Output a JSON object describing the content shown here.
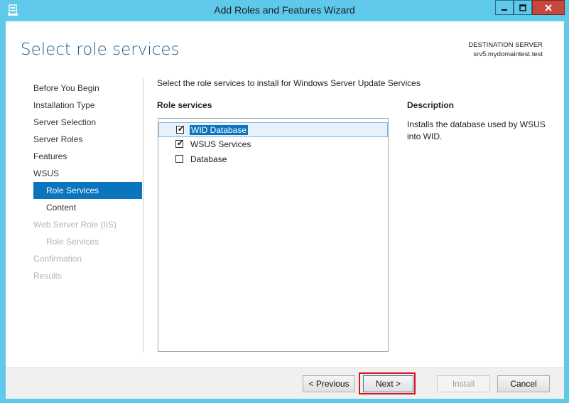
{
  "window": {
    "title": "Add Roles and Features Wizard",
    "controls": {
      "minimize": "minimize-icon",
      "maximize": "maximize-icon",
      "close": "close-icon"
    },
    "colors": {
      "frame": "#5fc9ec",
      "accent": "#0a74bd",
      "heading": "#1c5a8c",
      "highlight": "#e0141c"
    }
  },
  "header": {
    "title": "Select role services",
    "destination_label": "DESTINATION SERVER",
    "destination_server": "srv5.mydomaintest.test"
  },
  "nav": {
    "items": [
      {
        "label": "Before You Begin",
        "state": "normal"
      },
      {
        "label": "Installation Type",
        "state": "normal"
      },
      {
        "label": "Server Selection",
        "state": "normal"
      },
      {
        "label": "Server Roles",
        "state": "normal"
      },
      {
        "label": "Features",
        "state": "normal"
      },
      {
        "label": "WSUS",
        "state": "normal"
      },
      {
        "label": "Role Services",
        "state": "selected",
        "sub": true
      },
      {
        "label": "Content",
        "state": "normal",
        "sub": true
      },
      {
        "label": "Web Server Role (IIS)",
        "state": "disabled"
      },
      {
        "label": "Role Services",
        "state": "disabled",
        "sub": true
      },
      {
        "label": "Confirmation",
        "state": "disabled"
      },
      {
        "label": "Results",
        "state": "disabled"
      }
    ]
  },
  "main": {
    "intro": "Select the role services to install for Windows Server Update Services",
    "role_services_label": "Role services",
    "role_services": [
      {
        "label": "WID Database",
        "checked": true,
        "selected": true
      },
      {
        "label": "WSUS Services",
        "checked": true,
        "selected": false
      },
      {
        "label": "Database",
        "checked": false,
        "selected": false
      }
    ],
    "description_label": "Description",
    "description_text": "Installs the database used by WSUS into WID."
  },
  "footer": {
    "previous": "< Previous",
    "next": "Next >",
    "install": "Install",
    "cancel": "Cancel"
  }
}
